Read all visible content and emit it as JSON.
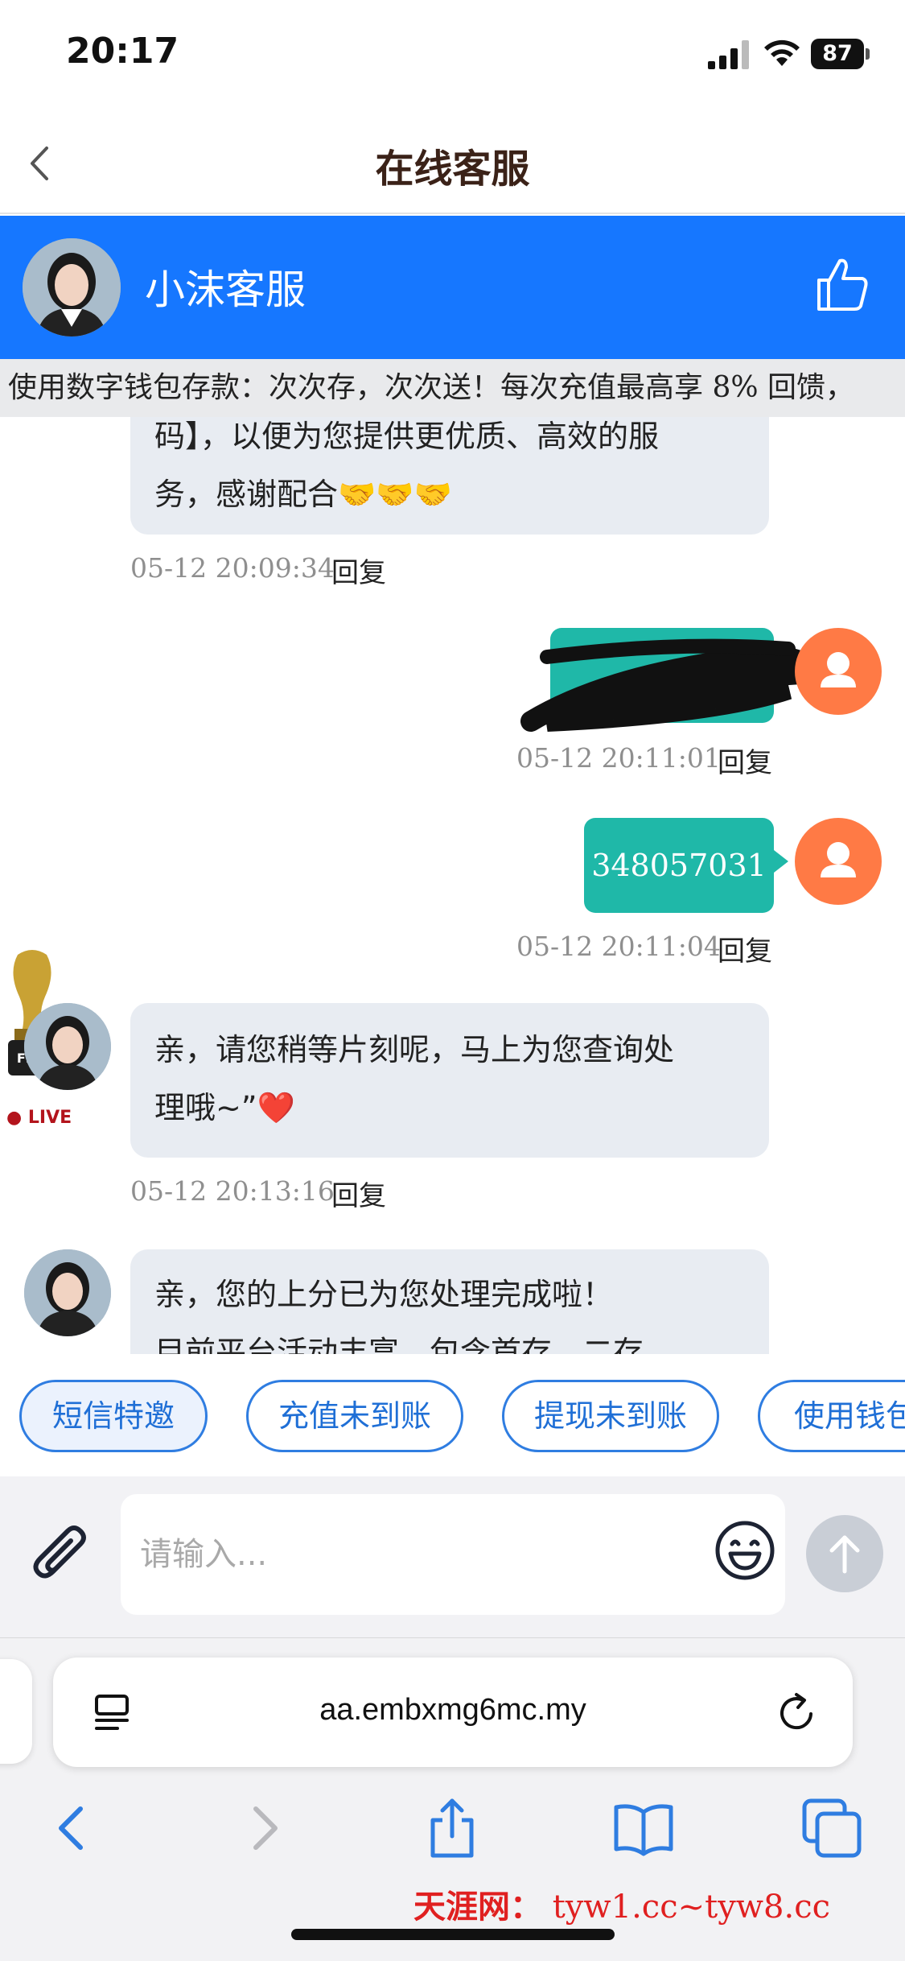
{
  "status_bar": {
    "time": "20:17",
    "battery": "87"
  },
  "header": {
    "title": "在线客服"
  },
  "agent": {
    "name": "小沫客服"
  },
  "marquee": {
    "text": "使用数字钱包存款：次次存，次次送！每次充值最高享 8% 回馈，"
  },
  "messages": [
    {
      "side": "left",
      "lines": [
        "码】，以便为您提供更优质、高效的服",
        "务，感谢配合🤝🤝🤝"
      ],
      "time": "05-12 20:09:34",
      "reply": "回复"
    },
    {
      "side": "right",
      "text": "",
      "time": "05-12 20:11:01",
      "reply": "回复",
      "redacted": true
    },
    {
      "side": "right",
      "text": "348057031",
      "time": "05-12 20:11:04",
      "reply": "回复"
    },
    {
      "side": "left",
      "lines": [
        "亲，请您稍等片刻呢，马上为您查询处",
        "理哦~”❤️"
      ],
      "time": "05-12 20:13:16",
      "reply": "回复"
    },
    {
      "side": "left",
      "lines": [
        "亲，您的上分已为您处理完成啦！",
        "目前平台活动丰富，包含首存、二存"
      ]
    }
  ],
  "badge": {
    "fifa": "FIFA",
    "live": "LIVE"
  },
  "quick_replies": [
    "短信特邀",
    "充值未到账",
    "提现未到账",
    "使用钱包"
  ],
  "input": {
    "placeholder": "请输入..."
  },
  "browser": {
    "url": "aa.embxmg6mc.my"
  },
  "watermark": {
    "site": "天涯网：",
    "domains": "tyw1.cc~tyw8.cc"
  },
  "colors": {
    "brand_blue": "#1677ff",
    "bubble_teal": "#1fb8a8",
    "user_avatar": "#ff7a45",
    "watermark_red": "#e02020"
  }
}
